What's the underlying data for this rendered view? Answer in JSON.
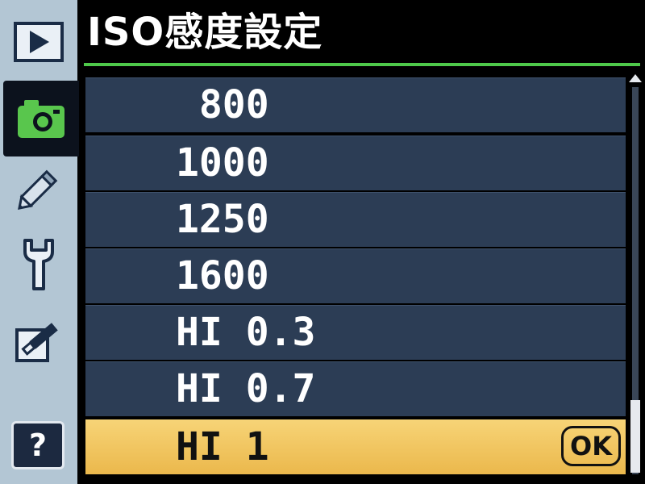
{
  "header": {
    "title": "ISO感度設定"
  },
  "sidebar": {
    "items": [
      {
        "name": "playback",
        "icon": "playback-icon"
      },
      {
        "name": "shooting",
        "icon": "camera-icon",
        "active": true
      },
      {
        "name": "custom-settings",
        "icon": "pencil-icon"
      },
      {
        "name": "setup",
        "icon": "wrench-icon"
      },
      {
        "name": "retouch",
        "icon": "retouch-brush-icon"
      }
    ],
    "help_label": "?"
  },
  "iso_list": {
    "options": [
      "800",
      "1000",
      "1250",
      "1600",
      "HI 0.3",
      "HI 0.7",
      "HI 1"
    ],
    "display": [
      " 800",
      "1000",
      "1250",
      "1600",
      "HI 0.3",
      "HI 0.7",
      "HI 1"
    ],
    "selected": "HI 1",
    "confirm_label": "OK"
  },
  "colors": {
    "accent_green": "#4ec94a",
    "selection_gold": "#ebb84c",
    "row_blue": "#2c3d55",
    "sidebar_blue": "#b3c6d4"
  }
}
